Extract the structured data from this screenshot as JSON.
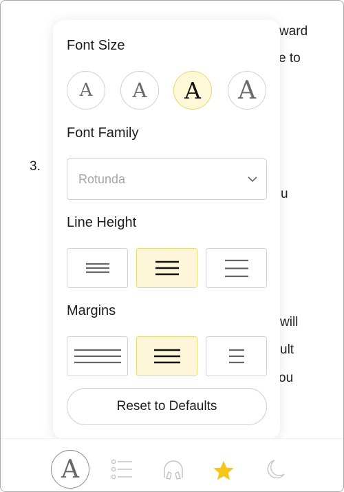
{
  "background_text": {
    "fragments": [
      "ward",
      "e to",
      "3.",
      "u",
      " will",
      "ult",
      "ou"
    ]
  },
  "settings_panel": {
    "font_size": {
      "title": "Font Size",
      "options": [
        {
          "glyph": "A",
          "label": "smallest",
          "selected": false
        },
        {
          "glyph": "A",
          "label": "small",
          "selected": false
        },
        {
          "glyph": "A",
          "label": "medium",
          "selected": true
        },
        {
          "glyph": "A",
          "label": "large",
          "selected": false
        }
      ]
    },
    "font_family": {
      "title": "Font Family",
      "selected_value": "Rotunda"
    },
    "line_height": {
      "title": "Line Height",
      "options": [
        {
          "label": "compact",
          "selected": false
        },
        {
          "label": "normal",
          "selected": true
        },
        {
          "label": "loose",
          "selected": false
        }
      ]
    },
    "margins": {
      "title": "Margins",
      "options": [
        {
          "label": "narrow",
          "selected": false
        },
        {
          "label": "medium",
          "selected": true
        },
        {
          "label": "wide",
          "selected": false
        }
      ]
    },
    "reset_label": "Reset to Defaults"
  },
  "bottom_bar": {
    "tabs": [
      {
        "icon": "font-settings-icon",
        "glyph": "A",
        "active": true
      },
      {
        "icon": "table-of-contents-icon",
        "active": false
      },
      {
        "icon": "headphones-icon",
        "active": false
      },
      {
        "icon": "star-icon",
        "active": false
      },
      {
        "icon": "moon-icon",
        "active": false
      }
    ]
  },
  "colors": {
    "accent_yellow": "#F5C518",
    "selected_fill": "#FDF8D8",
    "selected_border": "#E6D66A"
  }
}
